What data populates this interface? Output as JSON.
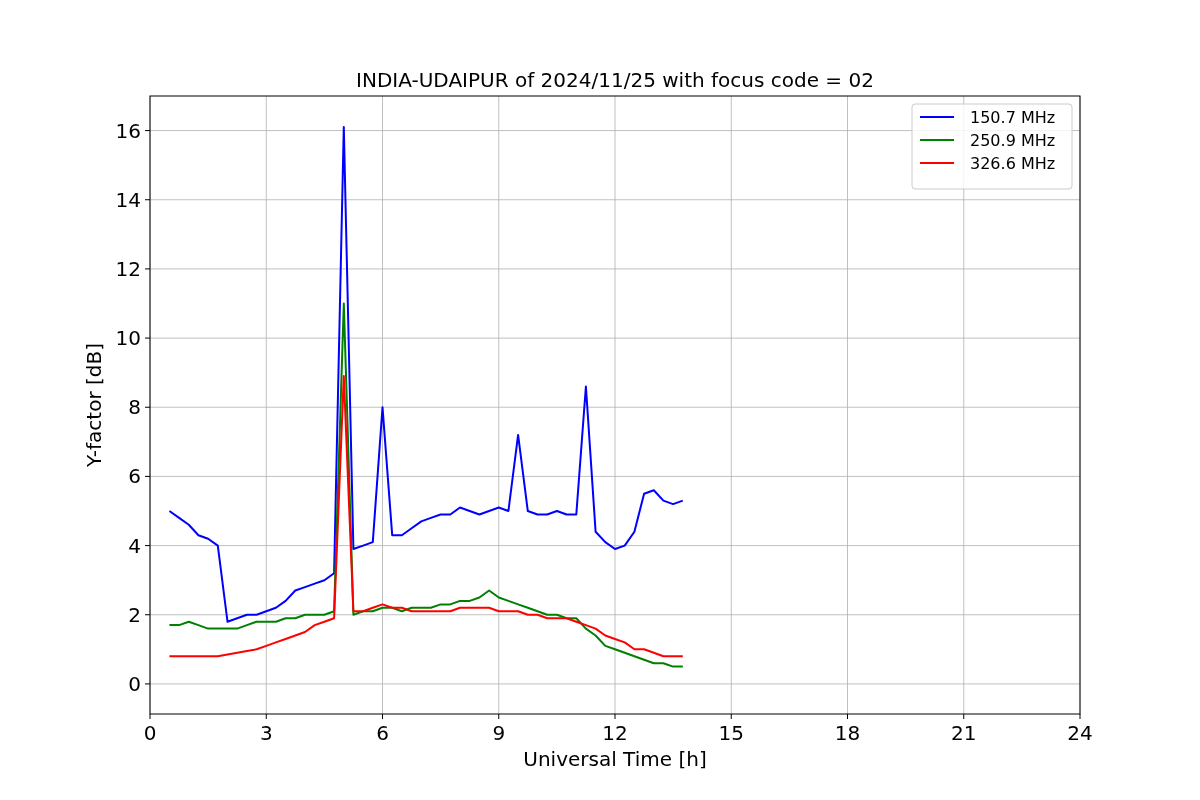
{
  "chart_data": {
    "type": "line",
    "title": "INDIA-UDAIPUR of 2024/11/25 with focus code = 02",
    "xlabel": "Universal Time [h]",
    "ylabel": "Y-factor [dB]",
    "x": [
      0.5,
      0.75,
      1,
      1.25,
      1.5,
      1.75,
      2,
      2.25,
      2.5,
      2.75,
      3,
      3.25,
      3.5,
      3.75,
      4,
      4.25,
      4.5,
      4.75,
      5,
      5.25,
      5.5,
      5.75,
      6,
      6.25,
      6.5,
      6.75,
      7,
      7.25,
      7.5,
      7.75,
      8,
      8.25,
      8.5,
      8.75,
      9,
      9.25,
      9.5,
      9.75,
      10,
      10.25,
      10.5,
      10.75,
      11,
      11.25,
      11.5,
      11.75,
      12,
      12.25,
      12.5,
      12.75,
      13,
      13.25,
      13.5,
      13.75
    ],
    "series": [
      {
        "name": "150.7 MHz",
        "color": "#0000ff",
        "values": [
          5.0,
          4.8,
          4.6,
          4.3,
          4.2,
          4.0,
          1.8,
          1.9,
          2.0,
          2.0,
          2.1,
          2.2,
          2.4,
          2.7,
          2.8,
          2.9,
          3.0,
          3.2,
          16.1,
          3.9,
          4.0,
          4.1,
          8.0,
          4.3,
          4.3,
          4.5,
          4.7,
          4.8,
          4.9,
          4.9,
          5.1,
          5.0,
          4.9,
          5.0,
          5.1,
          5.0,
          7.2,
          5.0,
          4.9,
          4.9,
          5.0,
          4.9,
          4.9,
          8.6,
          4.4,
          4.1,
          3.9,
          4.0,
          4.4,
          5.5,
          5.6,
          5.3,
          5.2,
          5.3
        ]
      },
      {
        "name": "250.9 MHz",
        "color": "#008000",
        "values": [
          1.7,
          1.7,
          1.8,
          1.7,
          1.6,
          1.6,
          1.6,
          1.6,
          1.7,
          1.8,
          1.8,
          1.8,
          1.9,
          1.9,
          2.0,
          2.0,
          2.0,
          2.1,
          11.0,
          2.0,
          2.1,
          2.1,
          2.2,
          2.2,
          2.1,
          2.2,
          2.2,
          2.2,
          2.3,
          2.3,
          2.4,
          2.4,
          2.5,
          2.7,
          2.5,
          2.4,
          2.3,
          2.2,
          2.1,
          2.0,
          2.0,
          1.9,
          1.9,
          1.6,
          1.4,
          1.1,
          1.0,
          0.9,
          0.8,
          0.7,
          0.6,
          0.6,
          0.5,
          0.5
        ]
      },
      {
        "name": "326.6 MHz",
        "color": "#ff0000",
        "values": [
          0.8,
          0.8,
          0.8,
          0.8,
          0.8,
          0.8,
          0.85,
          0.9,
          0.95,
          1.0,
          1.1,
          1.2,
          1.3,
          1.4,
          1.5,
          1.7,
          1.8,
          1.9,
          8.9,
          2.1,
          2.1,
          2.2,
          2.3,
          2.2,
          2.2,
          2.1,
          2.1,
          2.1,
          2.1,
          2.1,
          2.2,
          2.2,
          2.2,
          2.2,
          2.1,
          2.1,
          2.1,
          2.0,
          2.0,
          1.9,
          1.9,
          1.9,
          1.8,
          1.7,
          1.6,
          1.4,
          1.3,
          1.2,
          1.0,
          1.0,
          0.9,
          0.8,
          0.8,
          0.8
        ]
      }
    ],
    "xlim": [
      0,
      24
    ],
    "ylim": [
      -0.87,
      17
    ],
    "xticks": [
      0,
      3,
      6,
      9,
      12,
      15,
      18,
      21,
      24
    ],
    "yticks": [
      0,
      2,
      4,
      6,
      8,
      10,
      12,
      14,
      16
    ],
    "grid": true,
    "legend": true
  }
}
